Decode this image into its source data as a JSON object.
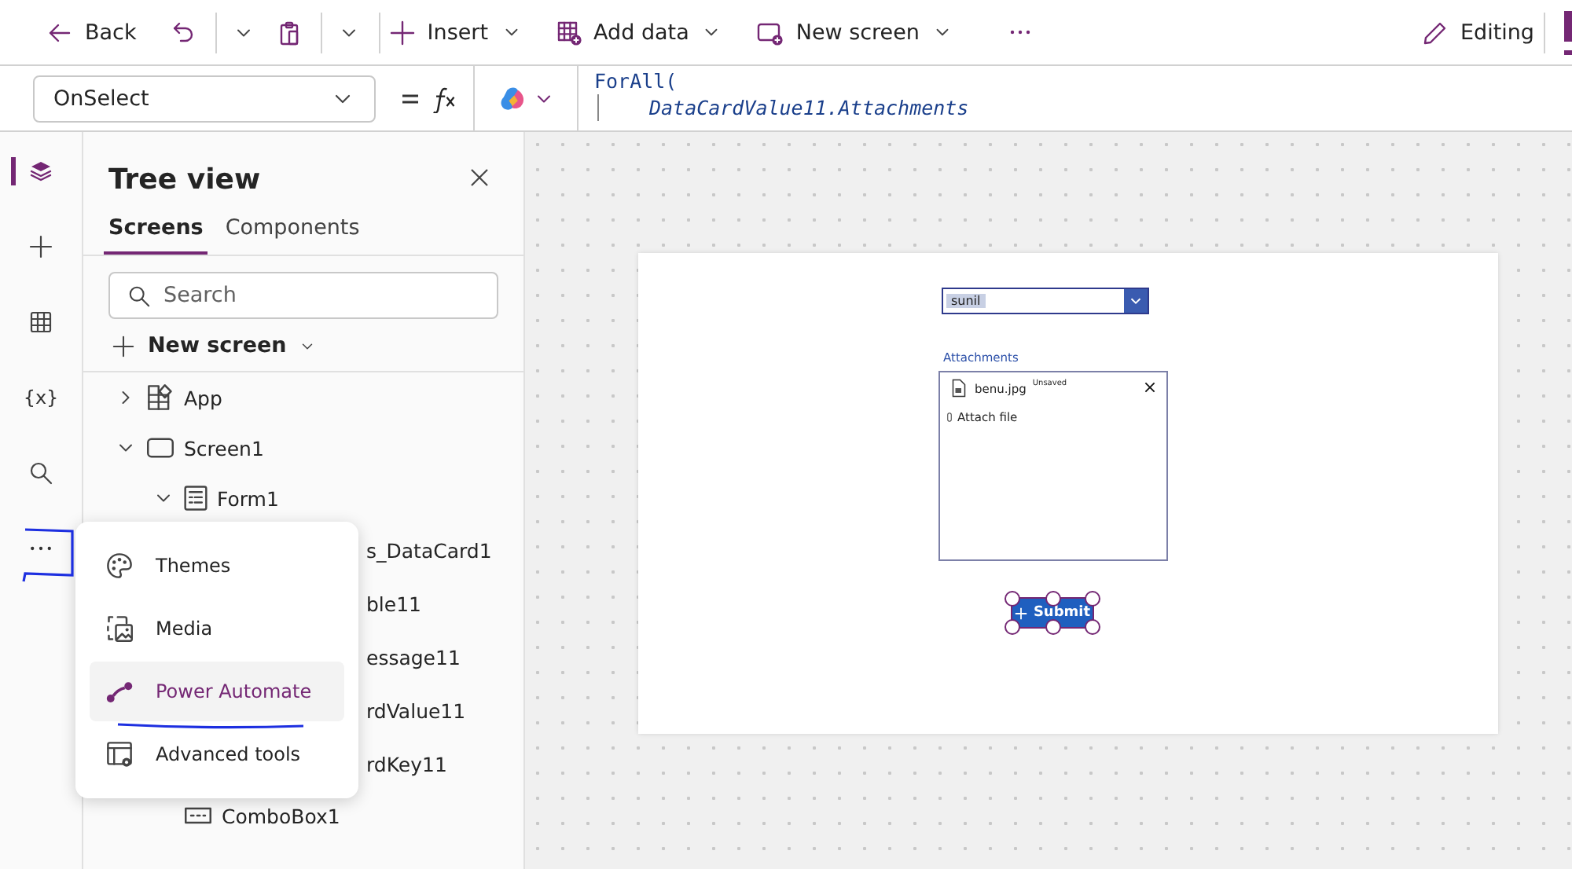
{
  "toolbar": {
    "items": [
      {
        "kind": "back",
        "label": "Back"
      },
      {
        "kind": "undo"
      },
      {
        "kind": "chevron"
      },
      {
        "kind": "paste"
      },
      {
        "kind": "chevron"
      },
      {
        "kind": "insert",
        "label": "Insert"
      },
      {
        "kind": "add_data",
        "label": "Add data"
      },
      {
        "kind": "new_screen",
        "label": "New screen"
      },
      {
        "kind": "more"
      }
    ],
    "mode": "Editing"
  },
  "formula_bar": {
    "property": "OnSelect",
    "code": [
      {
        "kind": "call",
        "text": "ForAll("
      },
      {
        "kind": "arg",
        "text": "DataCardValue11.Attachments"
      }
    ]
  },
  "rail": [
    {
      "kind": "layers",
      "selected": true
    },
    {
      "kind": "plus",
      "selected": false
    },
    {
      "kind": "table",
      "selected": false
    },
    {
      "kind": "variables",
      "label": "{x}",
      "selected": false
    },
    {
      "kind": "search",
      "selected": false
    },
    {
      "kind": "more",
      "selected": false
    }
  ],
  "tree_view": {
    "title": "Tree view",
    "tabs": [
      {
        "label": "Screens",
        "selected": true
      },
      {
        "label": "Components",
        "selected": false
      }
    ],
    "search": {
      "placeholder": "Search"
    },
    "new_screen": "New screen",
    "nodes": [
      {
        "kind": "app",
        "label": "App",
        "expanded": false
      },
      {
        "kind": "screen",
        "label": "Screen1",
        "expanded": true,
        "children": [
          {
            "kind": "form",
            "label": "Form1",
            "expanded": true,
            "children": [
              {
                "kind": "cut",
                "label": "s_DataCard1"
              },
              {
                "kind": "cut",
                "label": "ble11"
              },
              {
                "kind": "cut",
                "label": "essage11"
              },
              {
                "kind": "cut",
                "label": "rdValue11"
              },
              {
                "kind": "cut",
                "label": "rdKey11"
              }
            ]
          },
          {
            "kind": "combobox",
            "label": "ComboBox1"
          }
        ]
      }
    ]
  },
  "menu": [
    {
      "kind": "themes",
      "label": "Themes",
      "selected": false
    },
    {
      "kind": "media",
      "label": "Media",
      "selected": false
    },
    {
      "kind": "flow",
      "label": "Power Automate",
      "selected": true
    },
    {
      "kind": "tools",
      "label": "Advanced tools",
      "selected": false
    }
  ],
  "canvas": {
    "combobox": {
      "value": "sunil"
    },
    "attachments": {
      "label": "Attachments",
      "files": [
        {
          "name": "benu.jpg",
          "status": "Unsaved"
        }
      ],
      "add_label": "Attach file"
    },
    "submit": {
      "label": "Submit",
      "selected": true
    }
  }
}
